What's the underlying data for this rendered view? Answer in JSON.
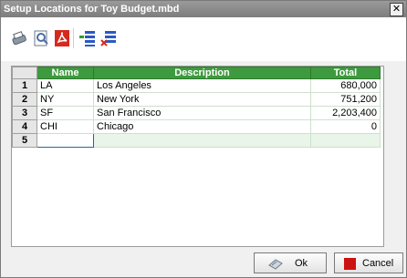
{
  "window": {
    "title": "Setup Locations for Toy Budget.mbd",
    "close_glyph": "✕"
  },
  "toolbar": {
    "buttons": [
      {
        "name": "print-icon",
        "color": "#6a7a8a"
      },
      {
        "name": "print-preview-icon",
        "color": "#4a6fa5"
      },
      {
        "name": "pdf-icon",
        "color": "#d6281e"
      },
      {
        "name": "insert-row-icon",
        "color": "#2b59c3"
      },
      {
        "name": "delete-row-icon",
        "color": "#2b59c3"
      }
    ]
  },
  "grid": {
    "columns": [
      "Name",
      "Description",
      "Total"
    ],
    "rows": [
      {
        "num": "1",
        "name": "LA",
        "description": "Los Angeles",
        "total": "680,000"
      },
      {
        "num": "2",
        "name": "NY",
        "description": "New York",
        "total": "751,200"
      },
      {
        "num": "3",
        "name": "SF",
        "description": "San Francisco",
        "total": "2,203,400"
      },
      {
        "num": "4",
        "name": "CHI",
        "description": "Chicago",
        "total": "0"
      },
      {
        "num": "5",
        "name": "",
        "description": "",
        "total": ""
      }
    ],
    "header_color": "#3e9a3e"
  },
  "buttons": {
    "ok": "Ok",
    "cancel": "Cancel",
    "cancel_color": "#cc1111"
  }
}
